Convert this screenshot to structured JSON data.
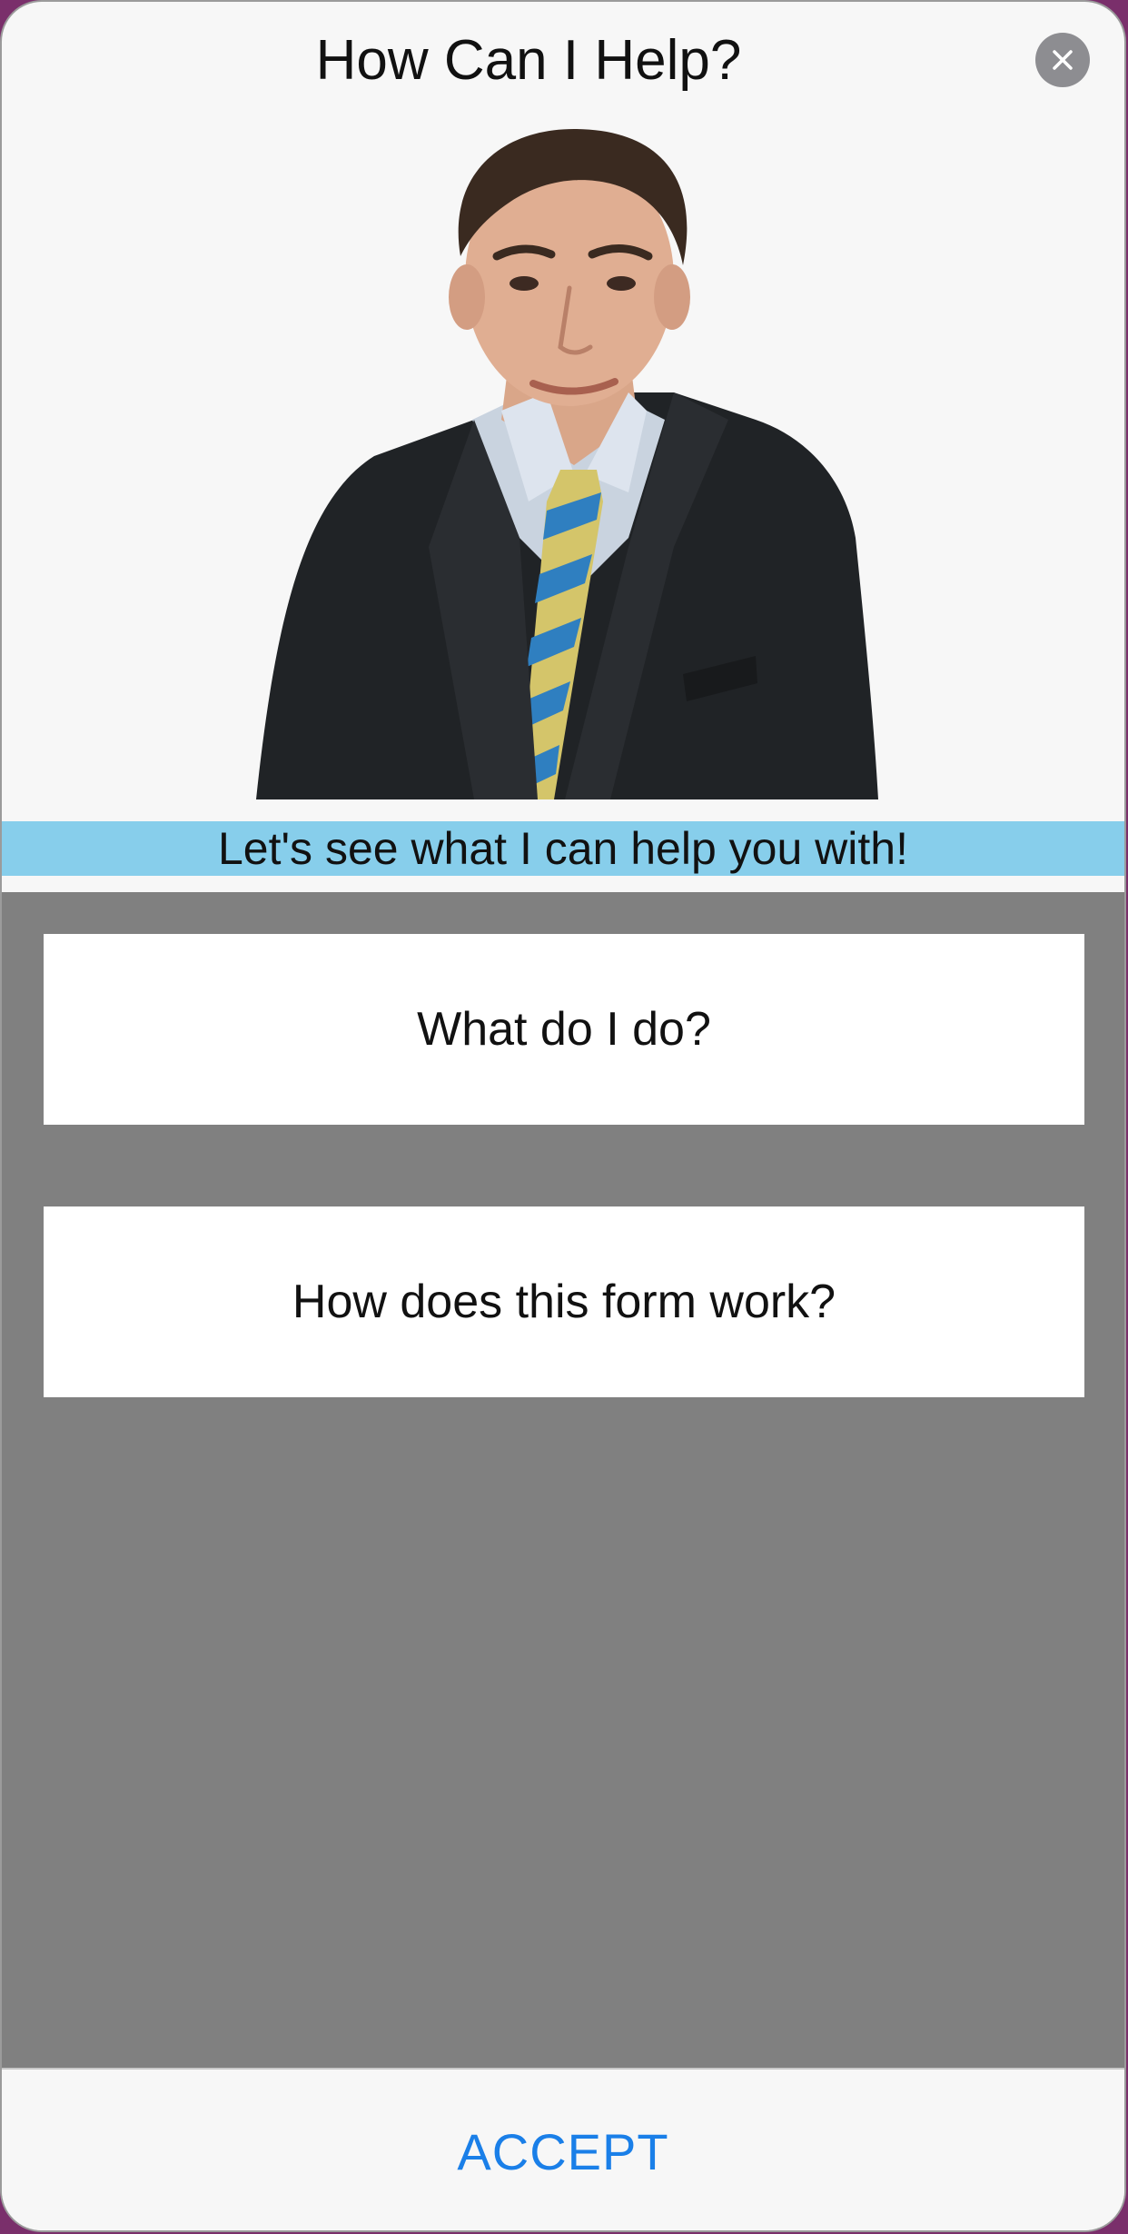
{
  "dialog": {
    "title": "How Can I Help?",
    "close_icon": "close-icon"
  },
  "banner": {
    "text": "Let's see what I can help you with!",
    "color": "#87ceeb"
  },
  "options": [
    {
      "label": "What do I do?"
    },
    {
      "label": "How does this form work?"
    }
  ],
  "footer": {
    "accept_label": "ACCEPT",
    "accent_color": "#1a7fe8"
  }
}
